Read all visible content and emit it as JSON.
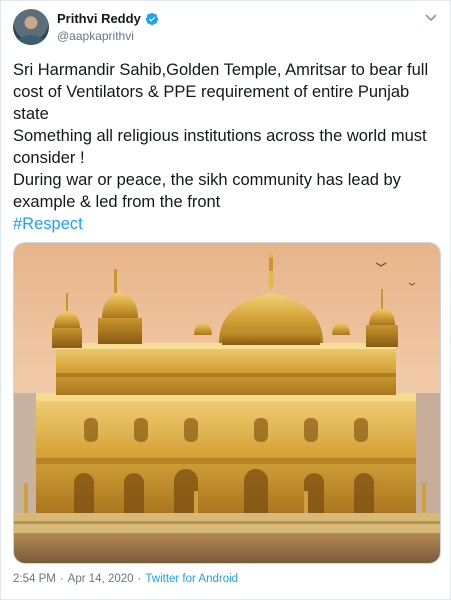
{
  "tweet": {
    "display_name": "Prithvi Reddy",
    "handle": "@aapkaprithvi",
    "verified": true,
    "text_lines": [
      "Sri Harmandir Sahib,Golden Temple, Amritsar to bear full cost of Ventilators & PPE requirement of entire Punjab state",
      "Something all religious institutions across the world must consider !",
      "During war or peace, the sikh community has lead by example & led from the front"
    ],
    "hashtag": "#Respect",
    "time": "2:54 PM",
    "separator": "·",
    "date": "Apr 14, 2020",
    "source": "Twitter for Android"
  },
  "media": {
    "alt": "Golden Temple photograph"
  },
  "colors": {
    "link": "#1da1f2",
    "verified": "#1da1f2",
    "muted": "#657786"
  }
}
